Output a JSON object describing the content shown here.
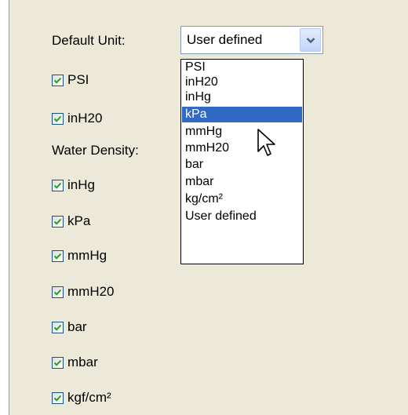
{
  "default_unit": {
    "label": "Default Unit:",
    "selected_value": "User defined"
  },
  "water_density_label": "Water Density:",
  "unit_checkboxes": [
    {
      "label": "PSI",
      "checked": true
    },
    {
      "label": "inH20",
      "checked": true
    },
    {
      "label": "inHg",
      "checked": true
    },
    {
      "label": "kPa",
      "checked": true
    },
    {
      "label": "mmHg",
      "checked": true
    },
    {
      "label": "mmH20",
      "checked": true
    },
    {
      "label": "bar",
      "checked": true
    },
    {
      "label": "mbar",
      "checked": true
    },
    {
      "label": "kgf/cm²",
      "checked": true
    }
  ],
  "dropdown": {
    "options": [
      "PSI",
      "inH20",
      "inHg",
      "kPa",
      "mmHg",
      "mmH20",
      "bar",
      "mbar",
      "kg/cm²",
      "User defined"
    ],
    "highlighted": "kPa"
  },
  "colors": {
    "panel_bg": "#ece9d8",
    "highlight": "#316ac5",
    "checkmark": "#21a121",
    "combo_border": "#7f9db9"
  }
}
